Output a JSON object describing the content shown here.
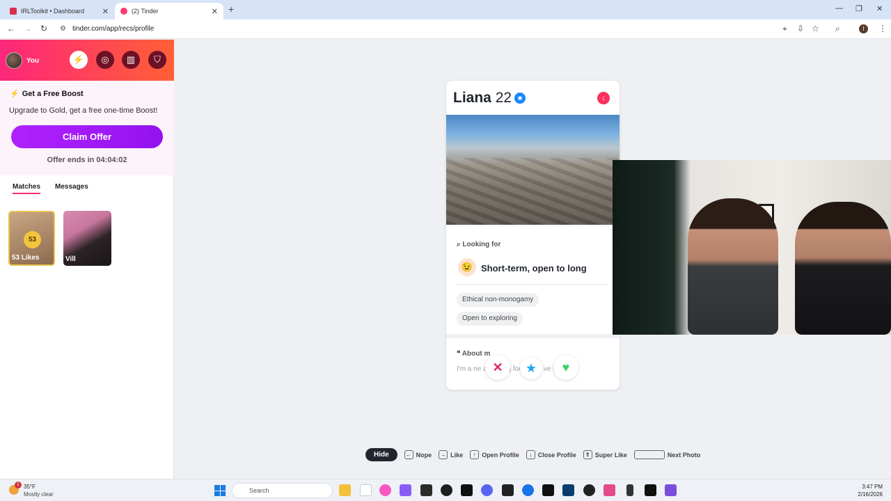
{
  "browser": {
    "tabs": [
      {
        "title": "IRLToolkit • Dashboard",
        "active": false
      },
      {
        "title": "(2) Tinder",
        "active": true
      }
    ],
    "url": "tinder.com/app/recs/profile"
  },
  "sidebar": {
    "user_label": "You",
    "boost": {
      "title": "Get a Free Boost",
      "subtitle": "Upgrade to Gold, get a free one-time Boost!",
      "button": "Claim Offer",
      "offer_ends": "Offer ends in 04:04:02"
    },
    "tabs": [
      "Matches",
      "Messages"
    ],
    "likes": {
      "count": "53",
      "label": "53 Likes"
    },
    "matches": [
      {
        "name": "Vill"
      }
    ]
  },
  "profile": {
    "name": "Liana",
    "age": "22",
    "looking_for": {
      "label": "Looking for",
      "value": "Short-term, open to long",
      "emoji": "😉"
    },
    "tags": [
      "Ethical non-monogamy",
      "Open to exploring"
    ],
    "about": {
      "label": "About m",
      "text": "I'm a ne        ar      nd       Big foodie an      ve to tere!"
    }
  },
  "hotkeys": {
    "hide": "Hide",
    "items": [
      {
        "key": "←",
        "label": "Nope"
      },
      {
        "key": "→",
        "label": "Like"
      },
      {
        "key": "↑",
        "label": "Open Profile"
      },
      {
        "key": "↓",
        "label": "Close Profile"
      },
      {
        "key": "⇧",
        "label": "Super Like"
      },
      {
        "key": "",
        "label": "Next Photo"
      }
    ]
  },
  "taskbar": {
    "weather": {
      "temp": "35°F",
      "condition": "Mostly clear",
      "badge": "1"
    },
    "search_placeholder": "Search",
    "time": "3:47 PM",
    "date": "2/16/2026"
  },
  "colors": {
    "tinder_gradient_start": "#fd267a",
    "tinder_gradient_end": "#ff6036",
    "gold_button": "#b021ff",
    "likes_gold": "#f2c53d"
  }
}
